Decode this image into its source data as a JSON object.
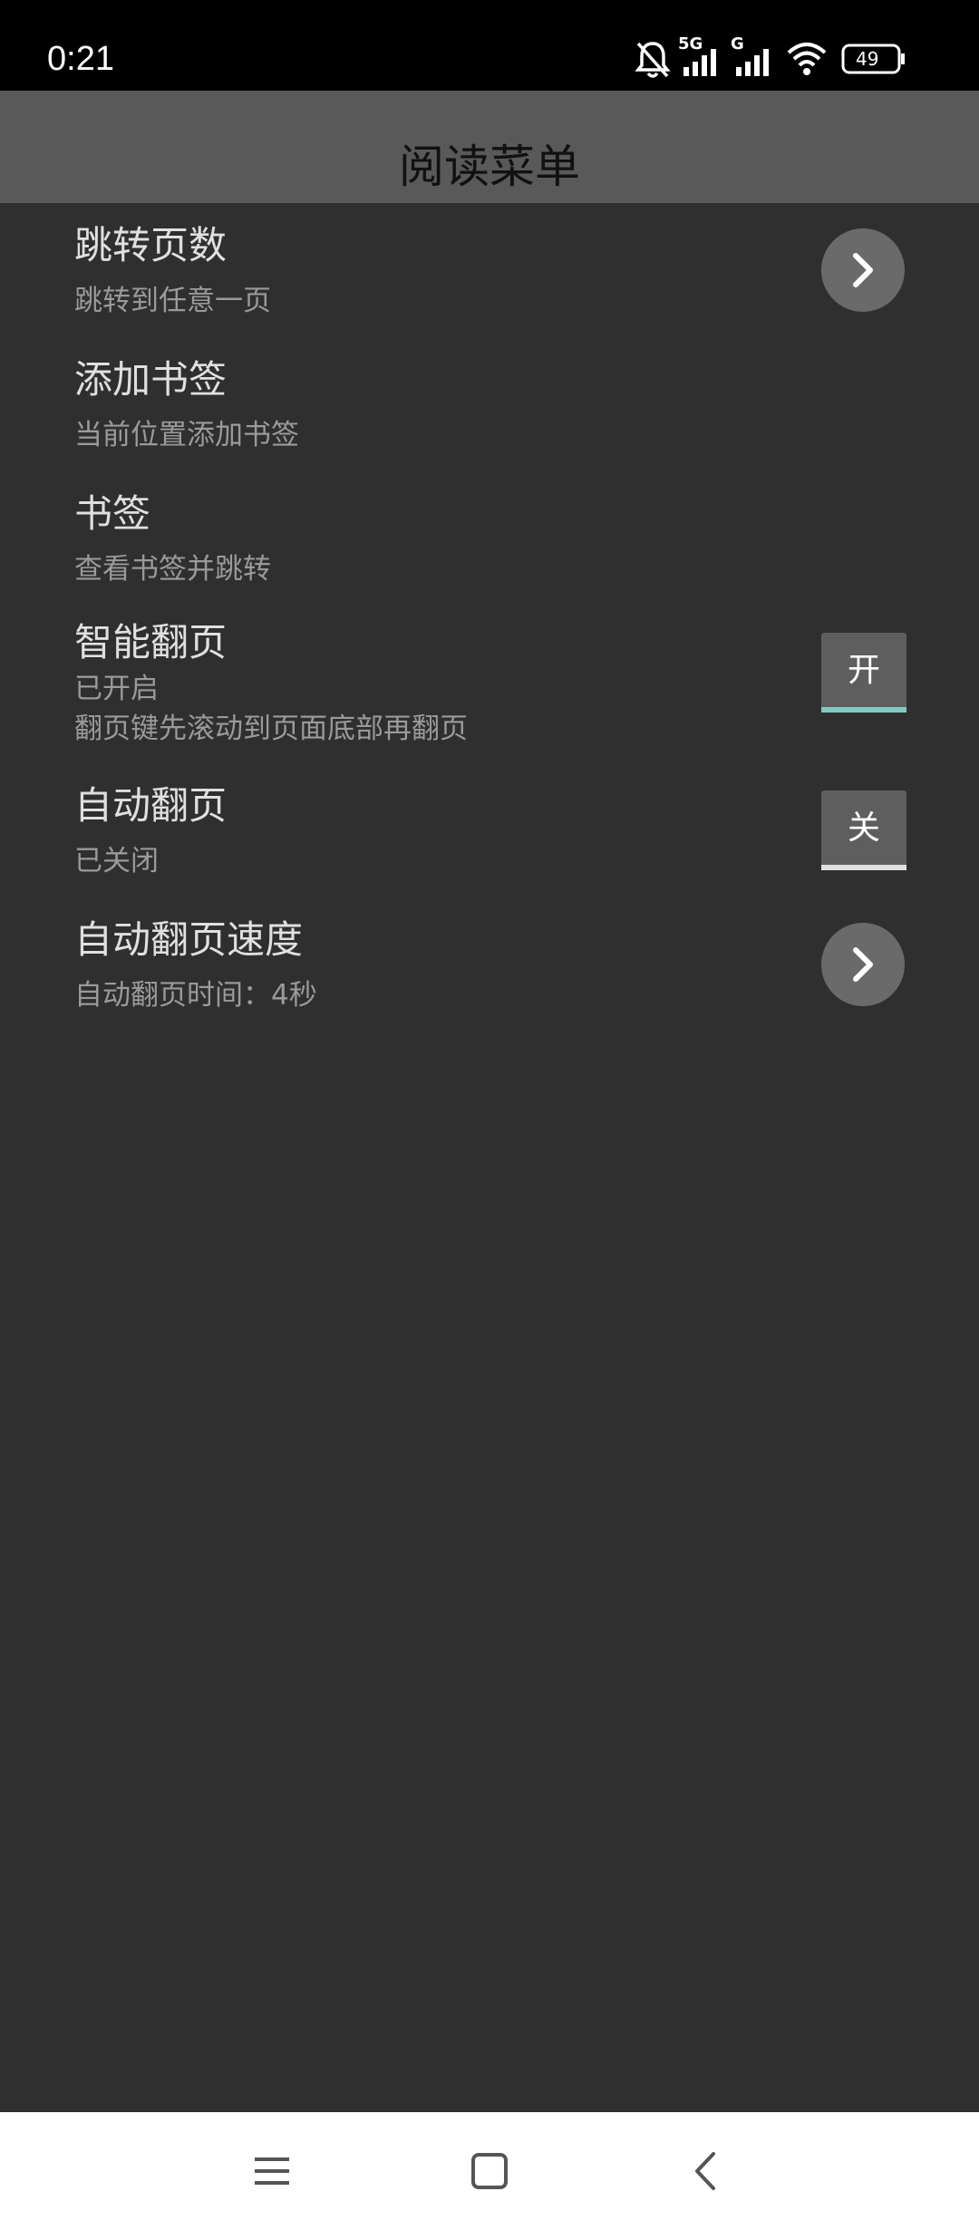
{
  "status_bar": {
    "time": "0:21",
    "network_label_1": "5G",
    "network_label_2": "G",
    "battery": "49",
    "icons": [
      "bell-muted-icon",
      "signal-icon",
      "signal-icon",
      "wifi-icon",
      "battery-icon"
    ]
  },
  "header": {
    "title": "阅读菜单"
  },
  "menu": {
    "items": [
      {
        "title": "跳转页数",
        "subtitle": "跳转到任意一页",
        "control": "chevron-right-icon"
      },
      {
        "title": "添加书签",
        "subtitle": "当前位置添加书签"
      },
      {
        "title": "书签",
        "subtitle": "查看书签并跳转"
      },
      {
        "title": "智能翻页",
        "subtitle": "已开启",
        "subtitle2": "翻页键先滚动到页面底部再翻页",
        "toggle_label": "开",
        "toggle_on": true
      },
      {
        "title": "自动翻页",
        "subtitle": "已关闭",
        "toggle_label": "关",
        "toggle_on": false
      },
      {
        "title": "自动翻页速度",
        "subtitle": "自动翻页时间：4秒",
        "control": "chevron-right-icon"
      }
    ]
  },
  "colors": {
    "background": "#2f2f2f",
    "header": "#595959",
    "toggle_on_indicator": "#80cbc4",
    "toggle_off_indicator": "#e0e0e0"
  },
  "nav_bar": {
    "icons": [
      "menu-icon",
      "home-icon",
      "back-icon"
    ]
  }
}
